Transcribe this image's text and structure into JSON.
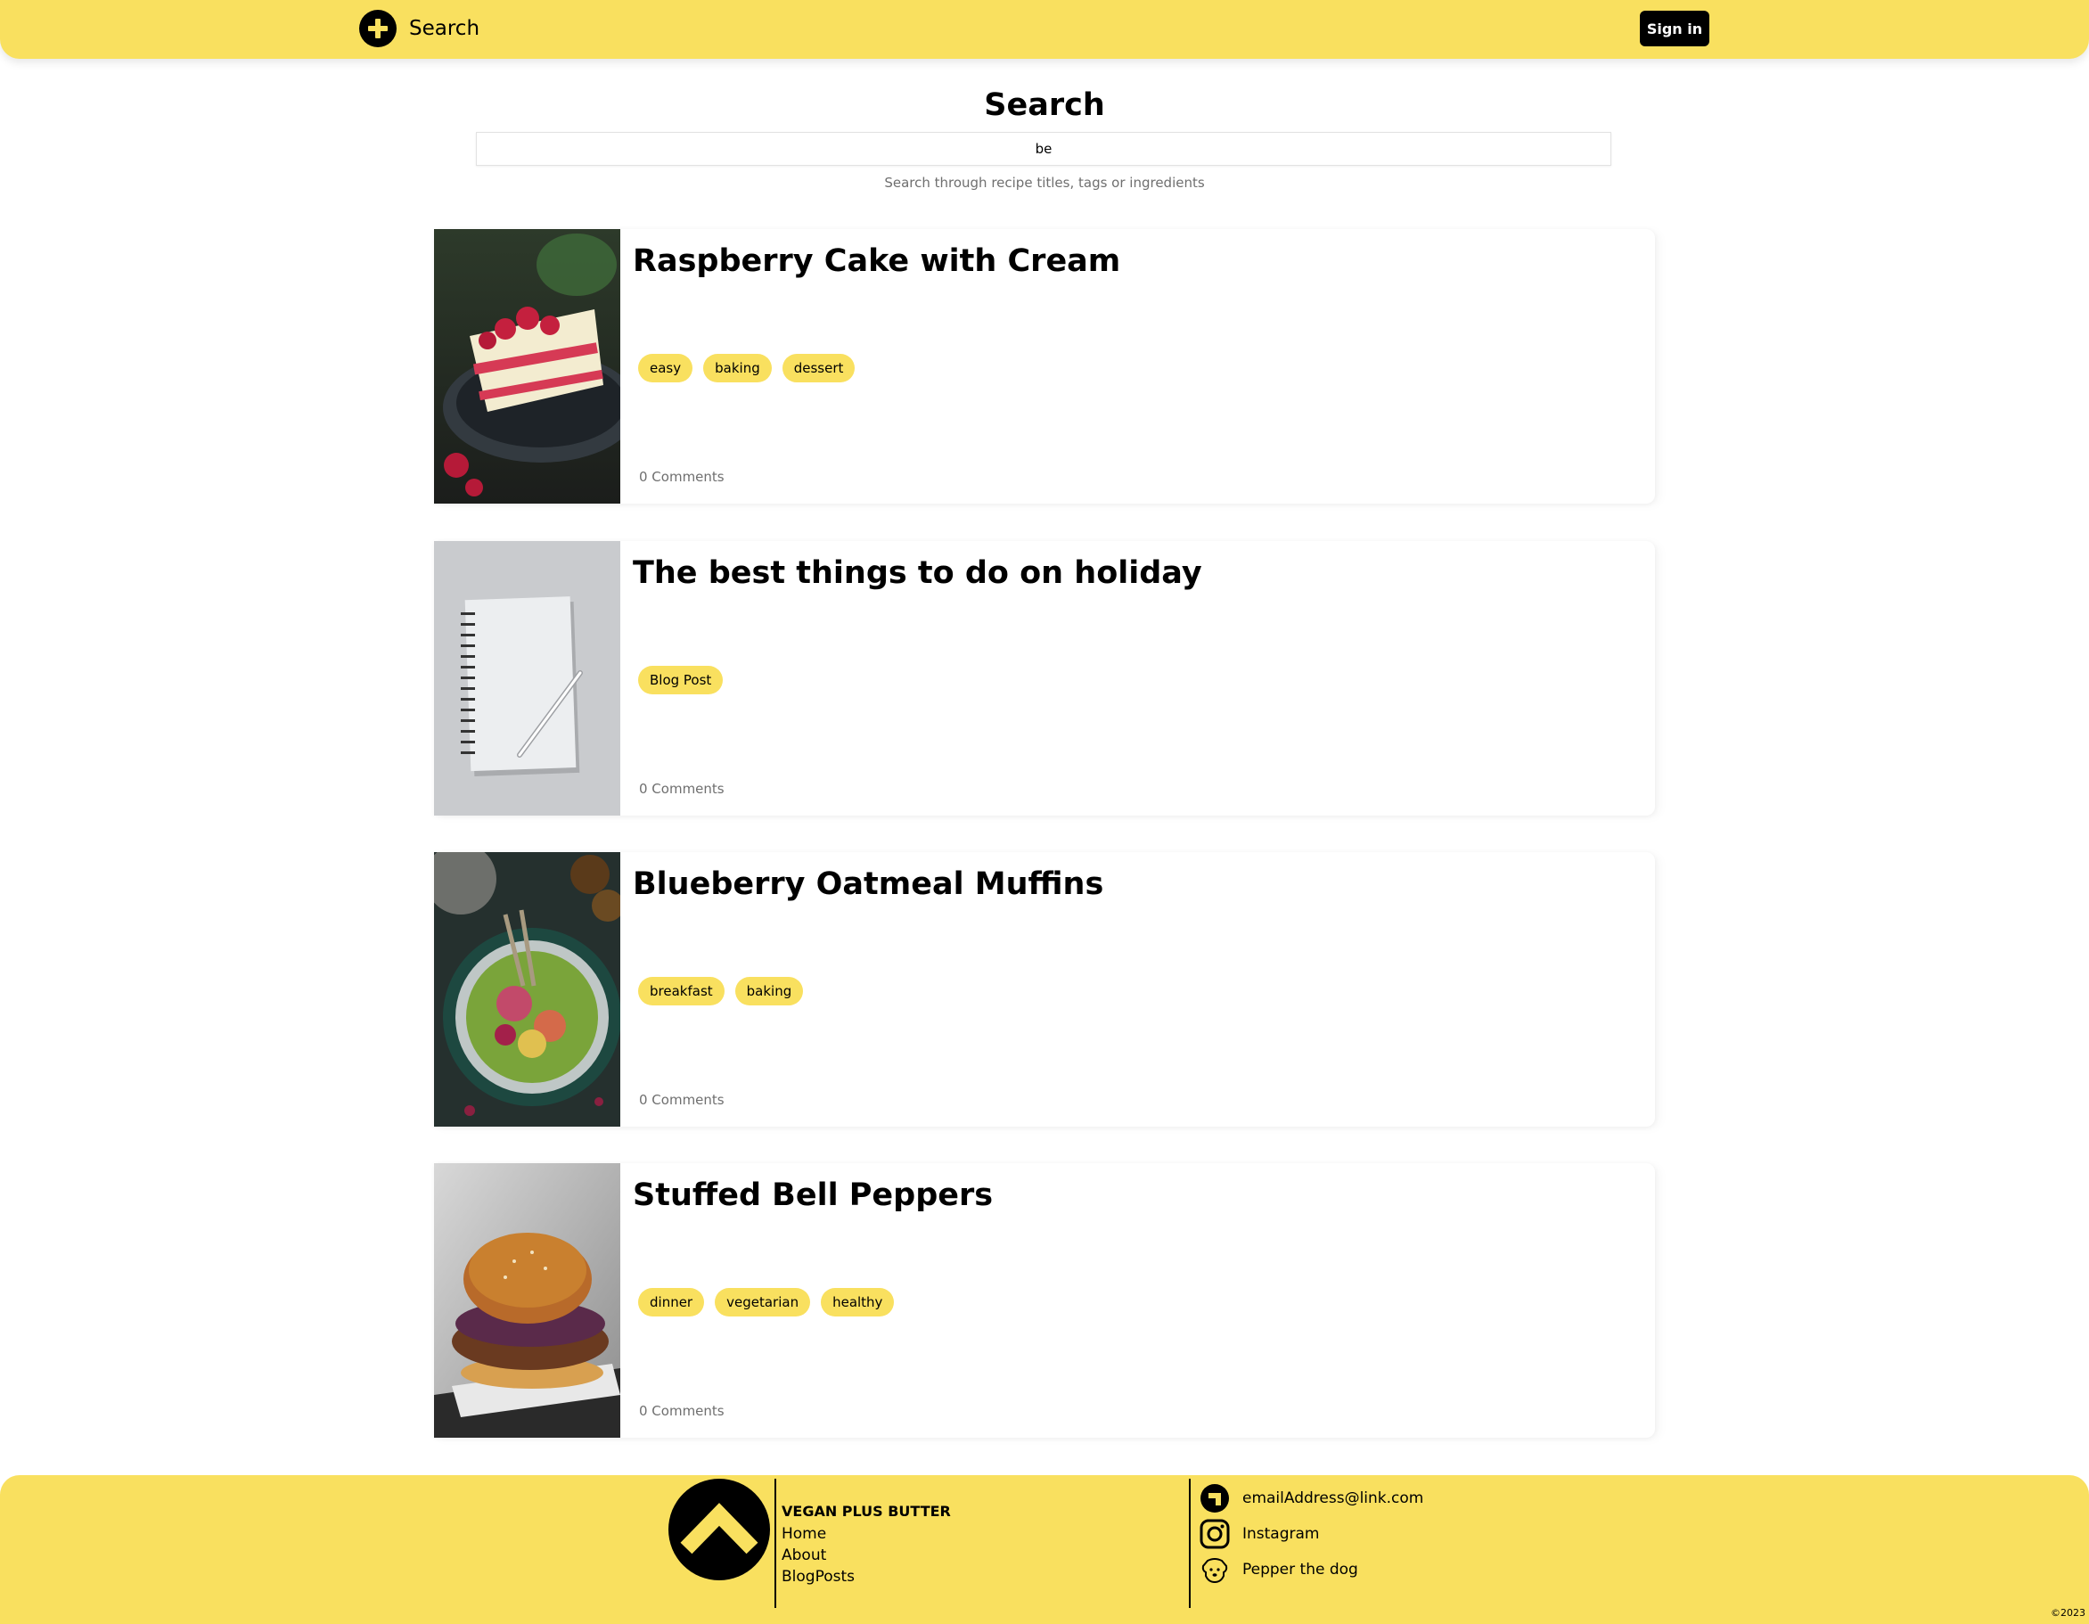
{
  "header": {
    "add_label": "Search",
    "signin_label": "Sign in"
  },
  "search": {
    "title": "Search",
    "query": "be",
    "help": "Search through recipe titles, tags or ingredients"
  },
  "results": [
    {
      "title": "Raspberry Cake with Cream",
      "tags": [
        "easy",
        "baking",
        "dessert"
      ],
      "comments": "0 Comments",
      "image": "raspberry-cake-photo"
    },
    {
      "title": "The best things to do on holiday",
      "tags": [
        "Blog Post"
      ],
      "comments": "0 Comments",
      "image": "notebook-pen-photo"
    },
    {
      "title": "Blueberry Oatmeal Muffins",
      "tags": [
        "breakfast",
        "baking"
      ],
      "comments": "0 Comments",
      "image": "salad-bowl-photo"
    },
    {
      "title": "Stuffed Bell Peppers",
      "tags": [
        "dinner",
        "vegetarian",
        "healthy"
      ],
      "comments": "0 Comments",
      "image": "burger-photo"
    }
  ],
  "footer": {
    "brand": "VEGAN PLUS BUTTER",
    "links": [
      "Home",
      "About",
      "BlogPosts"
    ],
    "email": "emailAddress@link.com",
    "instagram": "Instagram",
    "dog": "Pepper the dog",
    "copyright": "©2023"
  },
  "colors": {
    "accent": "#f9e05f",
    "text": "#000000",
    "muted": "#6f6f6f"
  }
}
